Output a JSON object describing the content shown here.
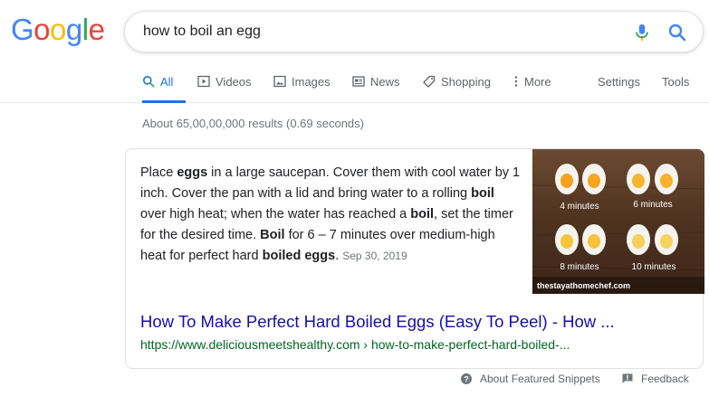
{
  "logo": {
    "text": "Google",
    "letters": [
      "G",
      "o",
      "o",
      "g",
      "l",
      "e"
    ],
    "colors": [
      "#4285F4",
      "#EA4335",
      "#FBBC05",
      "#4285F4",
      "#34A853",
      "#EA4335"
    ]
  },
  "search": {
    "query": "how to boil an egg"
  },
  "tabs": [
    {
      "label": "All",
      "icon": "search-icon",
      "active": true
    },
    {
      "label": "Videos",
      "icon": "play-icon"
    },
    {
      "label": "Images",
      "icon": "image-icon"
    },
    {
      "label": "News",
      "icon": "newspaper-icon"
    },
    {
      "label": "Shopping",
      "icon": "tag-icon"
    },
    {
      "label": "More",
      "icon": "more-vert-icon"
    }
  ],
  "tools": {
    "settings": "Settings",
    "tools": "Tools"
  },
  "stats": "About 65,00,00,000 results (0.69 seconds)",
  "featured": {
    "snippet": {
      "t1": "Place ",
      "b1": "eggs",
      "t2": " in a large saucepan. Cover them with cool water by 1 inch. Cover the pan with a lid and bring water to a rolling ",
      "b2": "boil",
      "t3": " over high heat; when the water has reached a ",
      "b3": "boil",
      "t4": ", set the timer for the desired time. ",
      "b4": "Boil",
      "t5": " for 6 – 7 minutes over medium-high heat for perfect hard ",
      "b5": "boiled eggs",
      "t6": ".",
      "date": "Sep 30, 2019"
    },
    "image": {
      "labels": [
        "4 minutes",
        "6 minutes",
        "8 minutes",
        "10 minutes"
      ],
      "watermark": "thestayathomechef.com"
    },
    "title": "How To Make Perfect Hard Boiled Eggs (Easy To Peel) - How ...",
    "url": "https://www.deliciousmeetshealthy.com › how-to-make-perfect-hard-boiled-..."
  },
  "footer": {
    "about": "About Featured Snippets",
    "feedback": "Feedback"
  },
  "colors": {
    "link": "#1a0dab",
    "url": "#006621",
    "accent": "#1a73e8"
  }
}
